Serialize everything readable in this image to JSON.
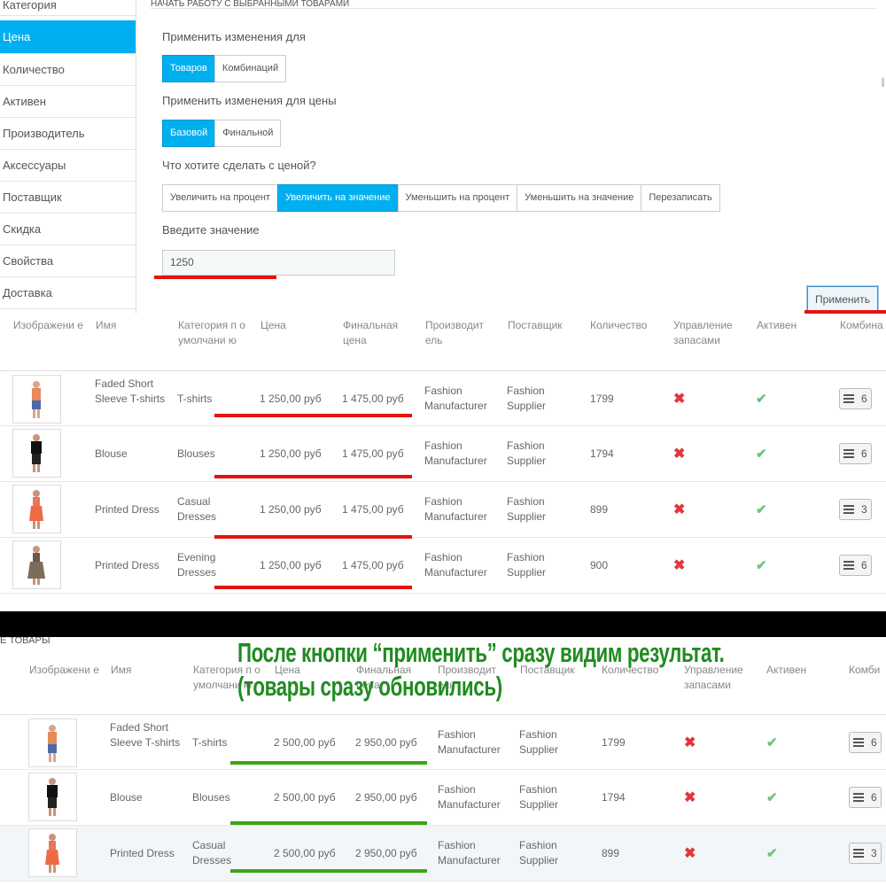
{
  "sidebar": {
    "items": [
      {
        "label": "Категория",
        "active": false
      },
      {
        "label": "Цена",
        "active": true
      },
      {
        "label": "Количество",
        "active": false
      },
      {
        "label": "Активен",
        "active": false
      },
      {
        "label": "Производитель",
        "active": false
      },
      {
        "label": "Аксессуары",
        "active": false
      },
      {
        "label": "Поставщик",
        "active": false
      },
      {
        "label": "Скидка",
        "active": false
      },
      {
        "label": "Свойства",
        "active": false
      },
      {
        "label": "Доставка",
        "active": false
      }
    ]
  },
  "panel": {
    "heading": "НАЧАТЬ РАБОТУ С ВЫБРАННЫМИ ТОВАРАМИ",
    "apply_to_label": "Применить изменения для",
    "apply_to_options": [
      "Товаров",
      "Комбинаций"
    ],
    "price_type_label": "Применить изменения для цены",
    "price_type_options": [
      "Базовой",
      "Финальной"
    ],
    "action_label": "Что хотите сделать с ценой?",
    "action_options": [
      "Увеличить на процент",
      "Увеличить на значение",
      "Уменьшить на процент",
      "Уменьшить на значение",
      "Перезаписать"
    ],
    "value_label": "Введите значение",
    "value": "1250",
    "apply_button": "Применить"
  },
  "table_headers": {
    "image": "Изображени е",
    "name": "Имя",
    "category": "Категория п о умолчани ю",
    "price": "Цена",
    "final_price": "Финальная цена",
    "manufacturer": "Производит ель",
    "supplier": "Поставщик",
    "quantity": "Количество",
    "stock": "Управление запасами",
    "active": "Активен",
    "combinations": "Комбина"
  },
  "table_headers_after": {
    "section_title": "Е ТОВАРЫ",
    "image": "Изображени е",
    "name": "Имя",
    "category": "Категория п о умолчани ю",
    "price": "Цена",
    "final_price": "Финальная цена",
    "manufacturer": "Производит ель",
    "supplier": "Поставщик",
    "quantity": "Количество",
    "stock": "Управление запасами",
    "active": "Активен",
    "combinations": "Комби"
  },
  "products_before": [
    {
      "name": "Faded Short Sleeve T-shirts",
      "category": "T-shirts",
      "price": "1 250,00 руб",
      "final_price": "1 475,00 руб",
      "manufacturer": "Fashion Manufacturer",
      "supplier": "Fashion Supplier",
      "quantity": "1799",
      "combinations": "6"
    },
    {
      "name": "Blouse",
      "category": "Blouses",
      "price": "1 250,00 руб",
      "final_price": "1 475,00 руб",
      "manufacturer": "Fashion Manufacturer",
      "supplier": "Fashion Supplier",
      "quantity": "1794",
      "combinations": "6"
    },
    {
      "name": "Printed Dress",
      "category": "Casual Dresses",
      "price": "1 250,00 руб",
      "final_price": "1 475,00 руб",
      "manufacturer": "Fashion Manufacturer",
      "supplier": "Fashion Supplier",
      "quantity": "899",
      "combinations": "3"
    },
    {
      "name": "Printed Dress",
      "category": "Evening Dresses",
      "price": "1 250,00 руб",
      "final_price": "1 475,00 руб",
      "manufacturer": "Fashion Manufacturer",
      "supplier": "Fashion Supplier",
      "quantity": "900",
      "combinations": "6"
    }
  ],
  "products_after": [
    {
      "name": "Faded Short Sleeve T-shirts",
      "category": "T-shirts",
      "price": "2 500,00 руб",
      "final_price": "2 950,00 руб",
      "manufacturer": "Fashion Manufacturer",
      "supplier": "Fashion Supplier",
      "quantity": "1799",
      "combinations": "6"
    },
    {
      "name": "Blouse",
      "category": "Blouses",
      "price": "2 500,00 руб",
      "final_price": "2 950,00 руб",
      "manufacturer": "Fashion Manufacturer",
      "supplier": "Fashion Supplier",
      "quantity": "1794",
      "combinations": "6"
    },
    {
      "name": "Printed Dress",
      "category": "Casual Dresses",
      "price": "2 500,00 руб",
      "final_price": "2 950,00 руб",
      "manufacturer": "Fashion Manufacturer",
      "supplier": "Fashion Supplier",
      "quantity": "899",
      "combinations": "3"
    }
  ],
  "annotation": {
    "line1": "После кнопки “применить” сразу видим результат.",
    "line2": "(товары сразу обновились)"
  },
  "colors": {
    "accent": "#00aff0",
    "red_mark": "#e3140f",
    "green_mark": "#3aa614",
    "annotation": "#1f8c1f"
  }
}
